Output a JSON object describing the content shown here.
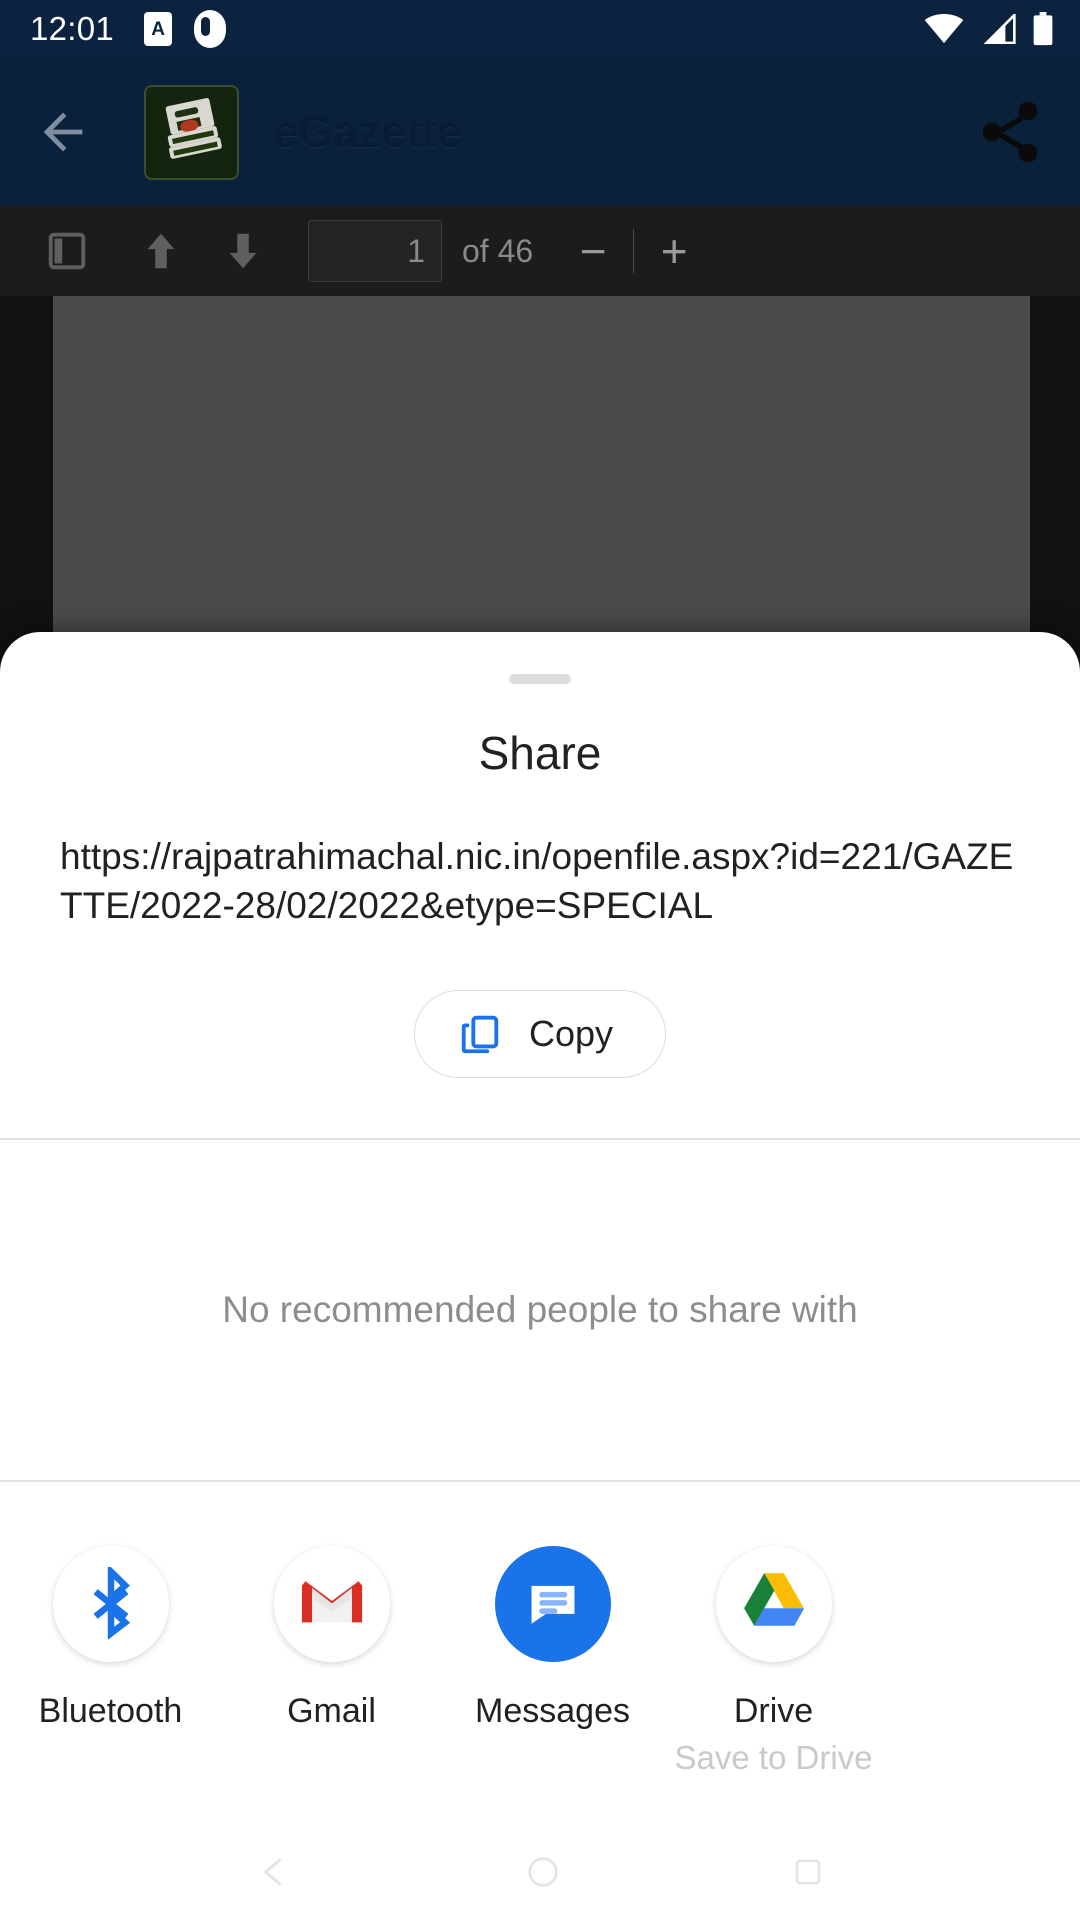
{
  "status_bar": {
    "clock": "12:01",
    "icons": [
      "a-badge-icon",
      "pocket-icon",
      "wifi-icon",
      "cellular-signal-icon",
      "battery-icon"
    ],
    "background": "#0c2340"
  },
  "app_bar": {
    "back_label": "",
    "title": "eGazette",
    "logo_name": "egazette-book-logo",
    "share_label": "",
    "background": "#0d2b4e",
    "title_color": "#0a1c33"
  },
  "pdf_toolbar": {
    "sidebar_toggle": "",
    "page_up": "",
    "page_down": "",
    "page_number": "1",
    "page_total": "of 46",
    "zoom_out": "−",
    "zoom_in": "+",
    "background": "#1c1c1c"
  },
  "pdf_view": {
    "page_background": "#4b4b4b",
    "viewer_background": "#111111"
  },
  "share_sheet": {
    "title": "Share",
    "url": "https://rajpatrahimachal.nic.in/openfile.aspx?id=221/GAZETTE/2022-28/02/2022&etype=SPECIAL",
    "copy_label": "Copy",
    "copy_icon_color": "#1a73e8",
    "empty_state": "No recommended people to share with",
    "apps": [
      {
        "label": "Bluetooth",
        "sublabel": "",
        "icon": "bluetooth-icon",
        "color": "#1a73e8"
      },
      {
        "label": "Gmail",
        "sublabel": "",
        "icon": "gmail-icon",
        "color": "#d93025"
      },
      {
        "label": "Messages",
        "sublabel": "",
        "icon": "messages-icon",
        "color": "#1a73e8"
      },
      {
        "label": "Drive",
        "sublabel": "Save to Drive",
        "icon": "google-drive-icon",
        "color": "#fbbc04"
      }
    ]
  },
  "nav_bar": {
    "back": "",
    "home": "",
    "recents": ""
  }
}
